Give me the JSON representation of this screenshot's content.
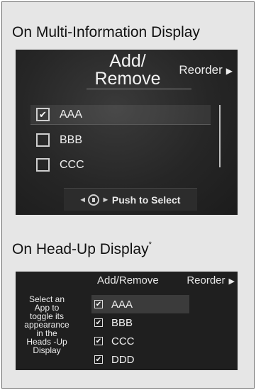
{
  "sections": [
    {
      "heading": "On Multi-Information Display"
    },
    {
      "heading": "On Head-Up Display",
      "footnote_mark": "*"
    }
  ],
  "mid": {
    "title_line1": "Add/",
    "title_line2": "Remove",
    "reorder_label": "Reorder",
    "items": [
      {
        "label": "AAA",
        "checked": true
      },
      {
        "label": "BBB",
        "checked": false
      },
      {
        "label": "CCC",
        "checked": false
      }
    ],
    "push_label": "Push to Select",
    "push_icon": "selector-dial-icon"
  },
  "hud": {
    "add_remove_label": "Add/Remove",
    "reorder_label": "Reorder",
    "hint_lines": [
      "Select an",
      "App to",
      "toggle its",
      "appearance",
      "in the",
      "Heads -Up",
      "Display"
    ],
    "items": [
      {
        "label": "AAA",
        "checked": true
      },
      {
        "label": "BBB",
        "checked": true
      },
      {
        "label": "CCC",
        "checked": true
      },
      {
        "label": "DDD",
        "checked": true
      }
    ]
  },
  "colors": {
    "page_background": "#e6e6e6",
    "screen_background": "#262626",
    "screen_text": "#f2f2f2"
  }
}
